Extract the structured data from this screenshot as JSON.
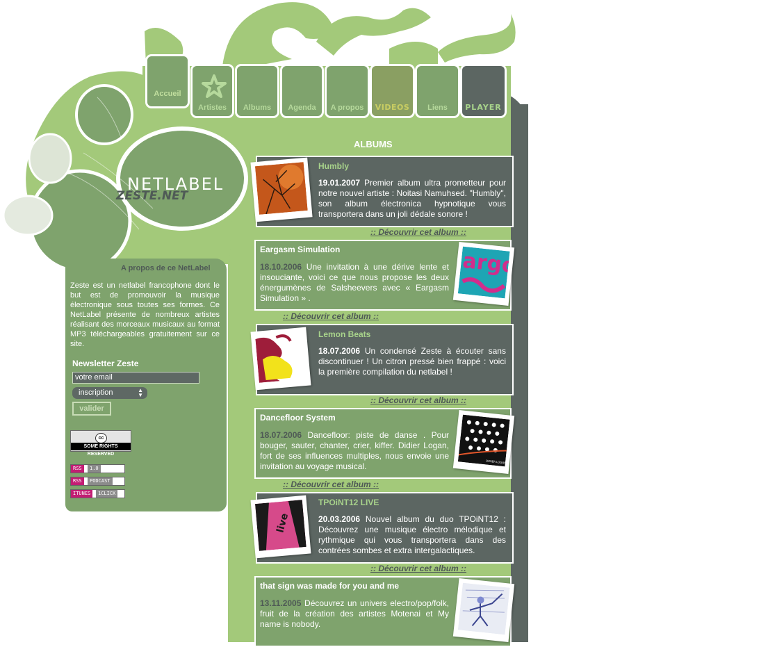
{
  "nav": {
    "tabs": [
      {
        "label": "Accueil"
      },
      {
        "label": "Artistes"
      },
      {
        "label": "Albums"
      },
      {
        "label": "Agenda"
      },
      {
        "label": "A propos"
      },
      {
        "label": "VIDEOS"
      },
      {
        "label": "Liens"
      },
      {
        "label": "PLAYER"
      }
    ]
  },
  "logo": {
    "main": "NETLABEL",
    "sub": "ZESTE.NET"
  },
  "sidebar": {
    "about_title": "A propos de ce NetLabel",
    "about_text": "Zeste est un netlabel francophone dont le but est de promouvoir la musique électronique sous toutes ses formes. Ce NetLabel présente de nombreux artistes réalisant des morceaux musicaux au format MP3 téléchargeables gratuitement sur ce site.",
    "newsletter": {
      "title": "Newsletter Zeste",
      "email_value": "votre email",
      "select_value": "inscription",
      "submit_label": "valider"
    },
    "cc_badge": "SOME RIGHTS RESERVED",
    "cc_logo": "cc",
    "badges": [
      {
        "left": "RSS",
        "right": "1.0"
      },
      {
        "left": "RSS",
        "right": "PODCAST"
      },
      {
        "left": "ITUNES",
        "right": "1CLICK"
      }
    ]
  },
  "main": {
    "title": "ALBUMS",
    "more_label": ":: Découvrir cet album ::",
    "albums": [
      {
        "title": "Humbly",
        "date": "19.01.2007",
        "text": "Premier album ultra prometteur pour notre nouvel artiste : Noitasi Namuhsed. \"Humbly\", son album électronica hypnotique vous transportera dans un joli dédale sonore !"
      },
      {
        "title": "Eargasm Simulation",
        "date": "18.10.2006",
        "text": "Une invitation à une dérive lente et insouciante, voici ce que nous propose les deux énergumènes de Salsheevers avec « Eargasm Simulation » ."
      },
      {
        "title": "Lemon Beats",
        "date": "18.07.2006",
        "text": "Un condensé Zeste à écouter sans discontinuer ! Un citron pressé bien frappé : voici la première compilation du netlabel !"
      },
      {
        "title": "Dancefloor System",
        "date": "18.07.2006",
        "text": "Dancefloor: piste de danse . Pour bouger, sauter, chanter, crier, kiffer. Didier Logan, fort de ses influences multiples, nous envoie une invitation au voyage musical."
      },
      {
        "title": "TPOiNT12 LIVE",
        "date": "20.03.2006",
        "text": "Nouvel album du duo TPOiNT12 : Découvrez une musique électro mélodique et rythmique qui vous transportera dans des contrées sombes et extra intergalactiques."
      },
      {
        "title": "that sign was made for you and me",
        "date": "13.11.2005",
        "text": "Découvrez un univers electro/pop/folk, fruit de la création des artistes Motenai et My name is nobody."
      }
    ],
    "cover_labels": {
      "eargasm": "argo",
      "dancefloor": "DIDIER LOGAN",
      "tpoint": "live"
    }
  },
  "colors": {
    "green": "#7fa36d",
    "light_green": "#a3c97a",
    "dark_grey": "#5c6662",
    "text_grey": "#4f5a56"
  }
}
